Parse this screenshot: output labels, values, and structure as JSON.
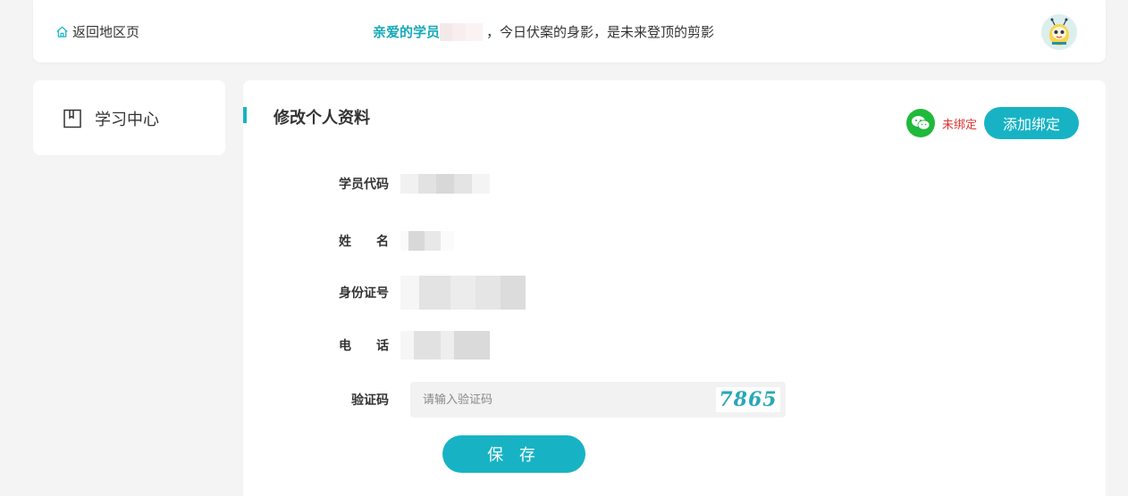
{
  "header": {
    "back_label": "返回地区页",
    "greeting_highlight": "亲爱的学员",
    "greeting_rest": "，今日伏案的身影，是未来登顶的剪影"
  },
  "sidebar": {
    "items": [
      {
        "label": "学习中心"
      }
    ]
  },
  "panel": {
    "title": "修改个人资料",
    "wechat_status": "未绑定",
    "bind_button": "添加绑定",
    "fields": {
      "student_code_label": "学员代码",
      "name_label": "姓　　名",
      "id_label": "身份证号",
      "phone_label": "电　　话",
      "captcha_label": "验证码"
    },
    "captcha": {
      "placeholder": "请输入验证码",
      "value": "",
      "image_text": "7865"
    },
    "save_button": "保 存"
  },
  "colors": {
    "accent": "#17b3c4",
    "highlight_text": "#17a9b8",
    "wechat": "#1fb93b",
    "unbound": "#dd3333",
    "background": "#f4f4f5"
  }
}
